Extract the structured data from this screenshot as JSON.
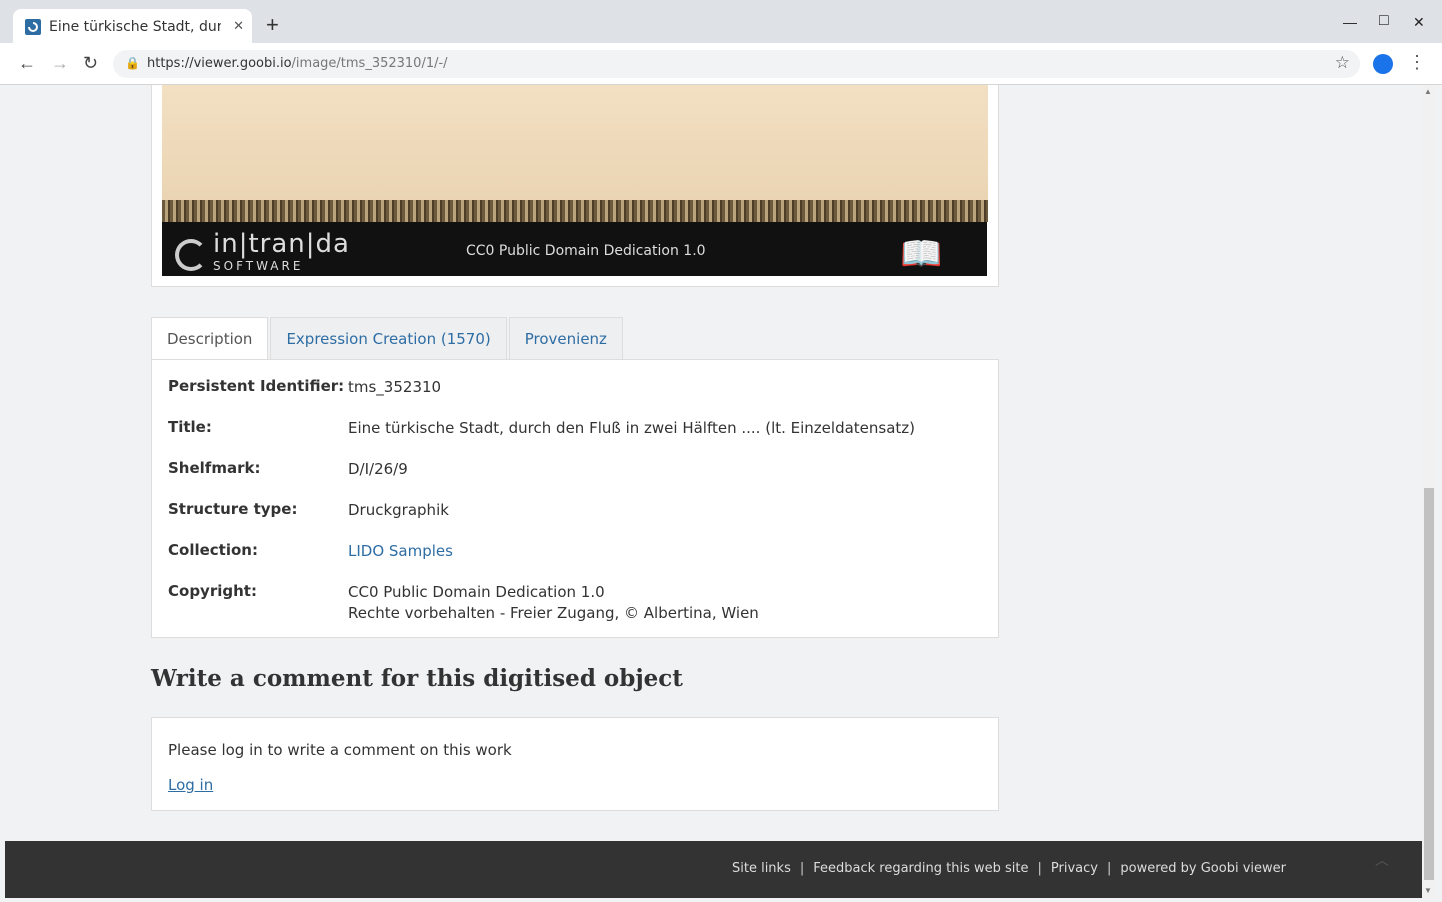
{
  "browser": {
    "tab_title": "Eine türkische Stadt, durch",
    "tab_close": "✕",
    "new_tab": "+",
    "url_host": "https://viewer.goobi.io",
    "url_path": "/image/tms_352310/1/-/",
    "controls": {
      "minimize": "—",
      "maximize": "□",
      "close": "✕"
    }
  },
  "image": {
    "logo_main": "in|tran|da",
    "logo_sub": "SOFTWARE",
    "license_caption": "CC0 Public Domain Dedication 1.0"
  },
  "tabs": [
    {
      "label": "Description",
      "active": true
    },
    {
      "label": "Expression Creation (1570)",
      "active": false
    },
    {
      "label": "Provenienz",
      "active": false
    }
  ],
  "metadata": {
    "pid_label": "Persistent Identifier:",
    "pid_value": "tms_352310",
    "title_label": "Title:",
    "title_value": "Eine türkische Stadt, durch den Fluß in zwei Hälften .... (lt. Einzeldatensatz)",
    "shelfmark_label": "Shelfmark:",
    "shelfmark_value": "D/I/26/9",
    "structure_label": "Structure type:",
    "structure_value": "Druckgraphik",
    "collection_label": "Collection:",
    "collection_value": "LIDO Samples",
    "copyright_label": "Copyright:",
    "copyright_line1": "CC0 Public Domain Dedication 1.0",
    "copyright_line2": "Rechte vorbehalten - Freier Zugang, © Albertina, Wien"
  },
  "comment": {
    "heading": "Write a comment for this digitised object",
    "prompt": "Please log in to write a comment on this work",
    "login": "Log in"
  },
  "footer": {
    "site_links": "Site links",
    "feedback": "Feedback regarding this web site",
    "privacy": "Privacy",
    "powered": "powered by Goobi viewer",
    "separator": "|"
  },
  "colors": {
    "link": "#2e6da4",
    "footer_bg": "#333333",
    "page_bg": "#f1f2f3"
  }
}
